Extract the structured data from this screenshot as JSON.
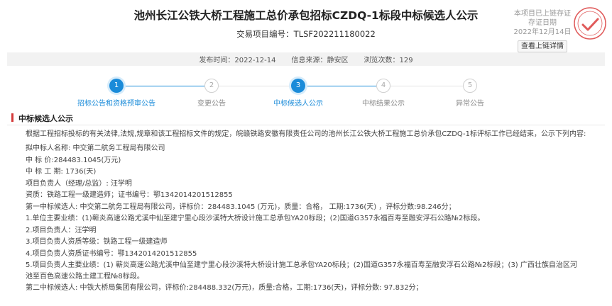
{
  "header": {
    "title": "池州长江公铁大桥工程施工总价承包招标CZDQ-1标段中标候选人公示",
    "project_no": "交易项目编号：TLSF202211180022"
  },
  "chain": {
    "line1": "本项目已上链存证",
    "line2": "存证日期",
    "line3": "2022年12月14日",
    "button": "查看上链详情"
  },
  "meta": {
    "publish_time": "发布时间：2022-12-14",
    "source": "信息来源：静安区",
    "views": "浏览次数：129"
  },
  "steps": [
    {
      "num": "1",
      "label": "招标公告和资格预审公告",
      "state": "done"
    },
    {
      "num": "2",
      "label": "变更公告",
      "state": "todo"
    },
    {
      "num": "3",
      "label": "中标候选人公示",
      "state": "done"
    },
    {
      "num": "4",
      "label": "中标结果公示",
      "state": "todo"
    },
    {
      "num": "5",
      "label": "异常公告",
      "state": "todo"
    }
  ],
  "section": {
    "title": "中标候选人公示"
  },
  "content": {
    "intro": "根据工程招标投标的有关法律,法规,规章和该工程招标文件的规定，皖赣铁路安徽有限责任公司的池州长江公铁大桥工程施工总价承包CZDQ-1标评标工作已经结束，公示下列内容:",
    "lines": [
      "拟中标人名称: 中交第二航务工程局有限公司",
      "中 标 价:284483.1045(万元)",
      "中 标 工 期: 1736(天)",
      "项目负责人（经理/总监）: 汪学明",
      "资质：铁路工程一级建造师；证书编号：鄂1342014201512855",
      "第一中标候选人: 中交第二航务工程局有限公司，评标价：284483.1045 (万元)，质量：合格， 工期:1736(天) ，评标分数:98.246分；",
      "1.单位主要业绩：(1)蕲炎高速公路尤溪中仙至建宁里心段沙溪特大桥设计施工总承包YA20标段；(2)国道G357永福百寿至融安浮石公路№2标段。",
      "2.项目负责人：汪学明",
      "3.项目负责人资质等级：铁路工程一级建造师",
      "4.项目负责人资质证书编号：鄂1342014201512855",
      "5.项目负责人主要业绩：(1) 蕲炎高速公路尤溪中仙至建宁里心段沙溪特大桥设计施工总承包YA20标段；(2)国道G357永福百寿至融安浮石公路№2标段；(3) 广西壮族自治区河池至百色高速公路土建工程№8标段。",
      "第二中标候选人: 中铁大桥局集团有限公司，评标价:284488.332(万元)，质量:合格，工期:1736(天)，评标分数: 97.832分；"
    ]
  },
  "colors": {
    "accent": "#1a8bd9",
    "stamp": "#e05a5a",
    "section_bar": "#d43a3a"
  }
}
